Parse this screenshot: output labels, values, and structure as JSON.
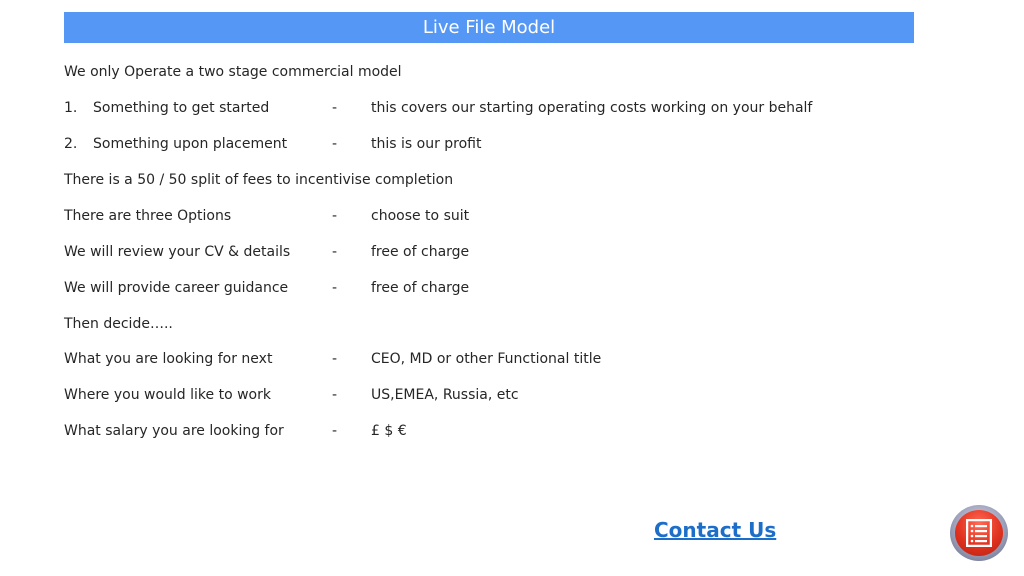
{
  "header": {
    "title": "Live File Model"
  },
  "intro": "We only Operate a two stage commercial model",
  "stages": [
    {
      "number": "1.",
      "label": "Something to get started",
      "dash": "-",
      "value": "this covers our starting operating costs working on your behalf"
    },
    {
      "number": "2.",
      "label": "Something upon placement",
      "dash": "-",
      "value": "this is our profit"
    }
  ],
  "split_note": "There is a 50 / 50 split of fees to incentivise completion",
  "options": [
    {
      "label": "There are three Options",
      "dash": "-",
      "value": "choose to suit"
    },
    {
      "label": "We will review your CV & details",
      "dash": "-",
      "value": "free of charge"
    },
    {
      "label": "We will provide career guidance",
      "dash": "-",
      "value": "free of charge"
    }
  ],
  "then_decide": "Then decide…..",
  "decisions": [
    {
      "label": "What you are looking for next",
      "dash": "-",
      "value": "CEO, MD or other Functional title"
    },
    {
      "label": "Where you would like to work",
      "dash": "-",
      "value": "US,EMEA, Russia, etc"
    },
    {
      "label": "What salary you are looking for",
      "dash": "-",
      "value": "£  $  €"
    }
  ],
  "footer": {
    "contact_label": "Contact Us",
    "menu_icon": "list-menu-icon"
  },
  "colors": {
    "title_bar": "#5597f4",
    "link": "#1c6ec9",
    "menu_button": "#e0321f"
  }
}
